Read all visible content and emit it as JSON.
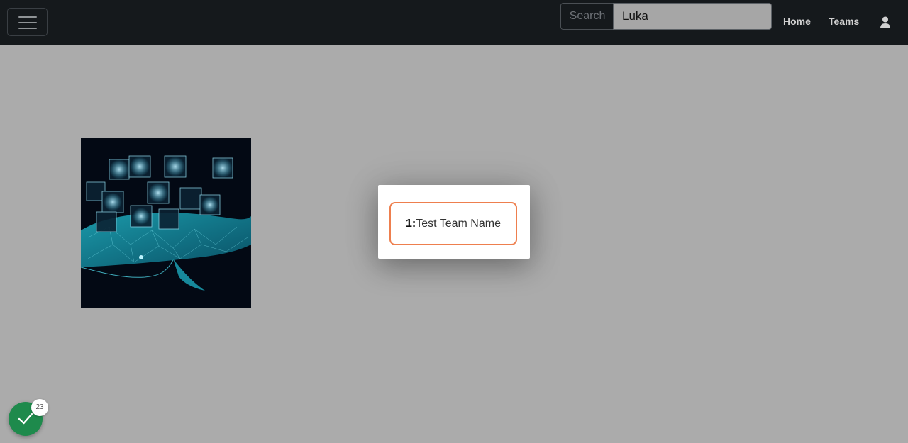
{
  "navbar": {
    "search_label": "Search",
    "search_value": "Luka",
    "links": {
      "home": "Home",
      "teams": "Teams"
    }
  },
  "modal": {
    "team": {
      "number": "1:",
      "name": "Test Team Name"
    }
  },
  "status": {
    "count": "23",
    "color": "#1e8a4c"
  },
  "colors": {
    "navbar_bg": "#15191c",
    "page_overlay": "#ababab",
    "highlight_border": "#ee7f4e"
  },
  "icons": {
    "menu": "hamburger-menu-icon",
    "user": "user-icon",
    "status": "checkmark-icon"
  }
}
